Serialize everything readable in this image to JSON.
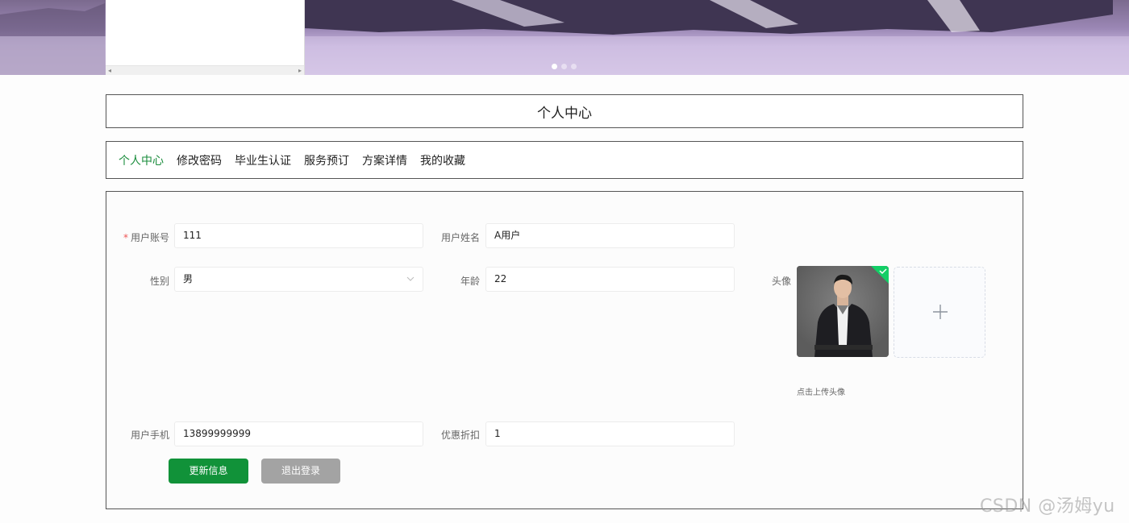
{
  "title": "个人中心",
  "tabs": [
    {
      "label": "个人中心"
    },
    {
      "label": "修改密码"
    },
    {
      "label": "毕业生认证"
    },
    {
      "label": "服务预订"
    },
    {
      "label": "方案详情"
    },
    {
      "label": "我的收藏"
    }
  ],
  "active_tab": "个人中心",
  "carousel": {
    "slide_count": 3,
    "active_slide": 1
  },
  "form": {
    "account": {
      "label": "用户账号",
      "value": "111",
      "required_mark": "*"
    },
    "name": {
      "label": "用户姓名",
      "value": "A用户"
    },
    "gender": {
      "label": "性别",
      "value": "男"
    },
    "age": {
      "label": "年龄",
      "value": "22"
    },
    "avatar": {
      "label": "头像",
      "tip": "点击上传头像"
    },
    "phone": {
      "label": "用户手机",
      "value": "13899999999"
    },
    "discount": {
      "label": "优惠折扣",
      "value": "1"
    }
  },
  "buttons": {
    "update": "更新信息",
    "logout": "退出登录"
  },
  "watermark": "CSDN @汤姆yu",
  "colors": {
    "accent": "#119239",
    "active_tab": "#1a8c3c",
    "logout": "#a3a3a3"
  }
}
